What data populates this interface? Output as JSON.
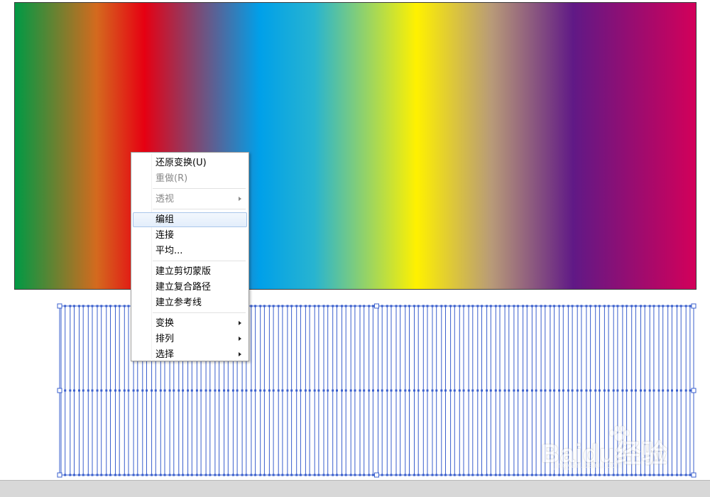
{
  "canvas": {
    "gradient_stops": [
      {
        "color": "#009944",
        "pos": 0.0
      },
      {
        "color": "#d46a1e",
        "pos": 0.12
      },
      {
        "color": "#e60012",
        "pos": 0.19
      },
      {
        "color": "#00a0e9",
        "pos": 0.36
      },
      {
        "color": "#28b4d0",
        "pos": 0.44
      },
      {
        "color": "#fff100",
        "pos": 0.59
      },
      {
        "color": "#b89a78",
        "pos": 0.7
      },
      {
        "color": "#601986",
        "pos": 0.82
      },
      {
        "color": "#d3005a",
        "pos": 1.0
      }
    ],
    "stripe_count": 70,
    "selection_color": "#3a5fcd"
  },
  "context_menu": {
    "items": [
      {
        "label": "还原变换(U)",
        "enabled": true,
        "submenu": false
      },
      {
        "label": "重做(R)",
        "enabled": false,
        "submenu": false
      },
      {
        "label": "透视",
        "enabled": false,
        "submenu": true
      },
      {
        "label": "编组",
        "enabled": true,
        "submenu": false,
        "highlighted": true
      },
      {
        "label": "连接",
        "enabled": true,
        "submenu": false
      },
      {
        "label": "平均...",
        "enabled": true,
        "submenu": false
      },
      {
        "label": "建立剪切蒙版",
        "enabled": true,
        "submenu": false
      },
      {
        "label": "建立复合路径",
        "enabled": true,
        "submenu": false
      },
      {
        "label": "建立参考线",
        "enabled": true,
        "submenu": false
      },
      {
        "label": "变换",
        "enabled": true,
        "submenu": true
      },
      {
        "label": "排列",
        "enabled": true,
        "submenu": true
      },
      {
        "label": "选择",
        "enabled": true,
        "submenu": true
      }
    ]
  },
  "watermark": {
    "text": "Baidu经验",
    "sub": "jingyan.baidu.com"
  }
}
